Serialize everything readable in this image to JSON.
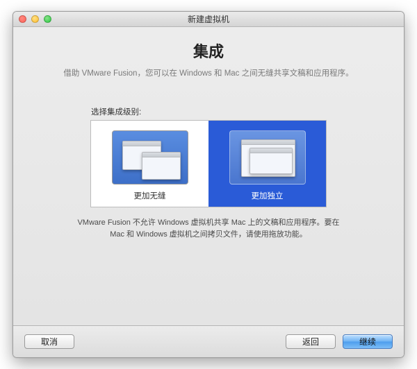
{
  "window": {
    "title": "新建虚拟机"
  },
  "header": {
    "heading": "集成",
    "subheading": "借助 VMware Fusion，您可以在 Windows 和 Mac 之间无缝共享文稿和应用程序。"
  },
  "section": {
    "label": "选择集成级别:"
  },
  "options": {
    "seamless": {
      "label": "更加无缝",
      "selected": false
    },
    "isolated": {
      "label": "更加独立",
      "selected": true
    }
  },
  "description": "VMware Fusion 不允许 Windows 虚拟机共享 Mac 上的文稿和应用程序。要在 Mac 和 Windows 虚拟机之间拷贝文件，请使用拖放功能。",
  "buttons": {
    "cancel": "取消",
    "back": "返回",
    "continue": "继续"
  }
}
